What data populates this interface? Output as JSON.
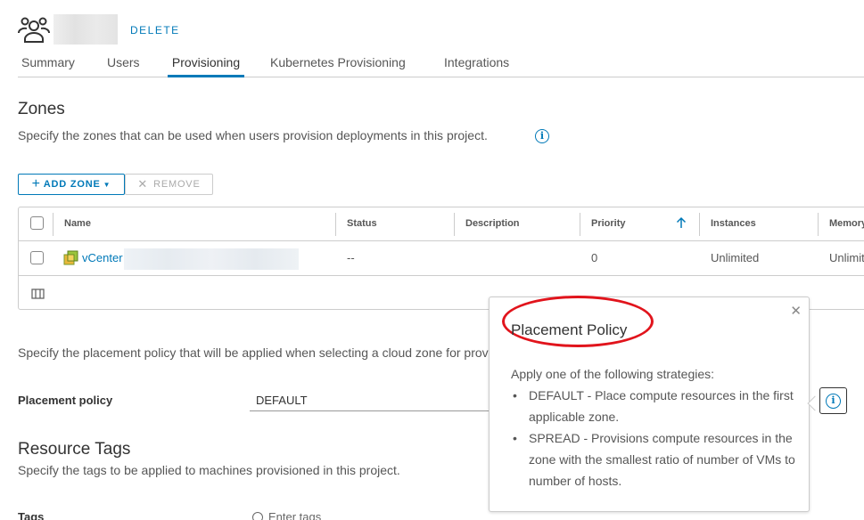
{
  "header": {
    "icon": "users-group-icon",
    "delete_label": "DELETE"
  },
  "tabs": [
    {
      "label": "Summary"
    },
    {
      "label": "Users"
    },
    {
      "label": "Provisioning",
      "active": true
    },
    {
      "label": "Kubernetes Provisioning"
    },
    {
      "label": "Integrations"
    }
  ],
  "zones": {
    "title": "Zones",
    "description": "Specify the zones that can be used when users provision deployments in this project.",
    "add_zone_label": "ADD ZONE",
    "remove_label": "REMOVE",
    "columns": {
      "name": "Name",
      "status": "Status",
      "description": "Description",
      "priority": "Priority",
      "instances": "Instances",
      "memory": "Memory"
    },
    "rows": [
      {
        "name": "vCenter",
        "status": "--",
        "description": "",
        "priority": "0",
        "instances": "Unlimited",
        "memory": "Unlimited"
      }
    ]
  },
  "placement": {
    "description": "Specify the placement policy that will be applied when selecting a cloud zone for provisioning.",
    "label": "Placement policy",
    "value": "DEFAULT"
  },
  "popover": {
    "title": "Placement Policy",
    "intro": "Apply one of the following strategies:",
    "items": [
      "DEFAULT - Place compute resources in the first applicable zone.",
      "SPREAD - Provisions compute resources in the zone with the smallest ratio of number of VMs to number of hosts."
    ]
  },
  "resource_tags": {
    "title": "Resource Tags",
    "description": "Specify the tags to be applied to machines provisioned in this project.",
    "tags_label": "Tags",
    "tags_placeholder": "Enter tags"
  },
  "colors": {
    "accent": "#0079b8",
    "highlight": "#e1141c"
  }
}
